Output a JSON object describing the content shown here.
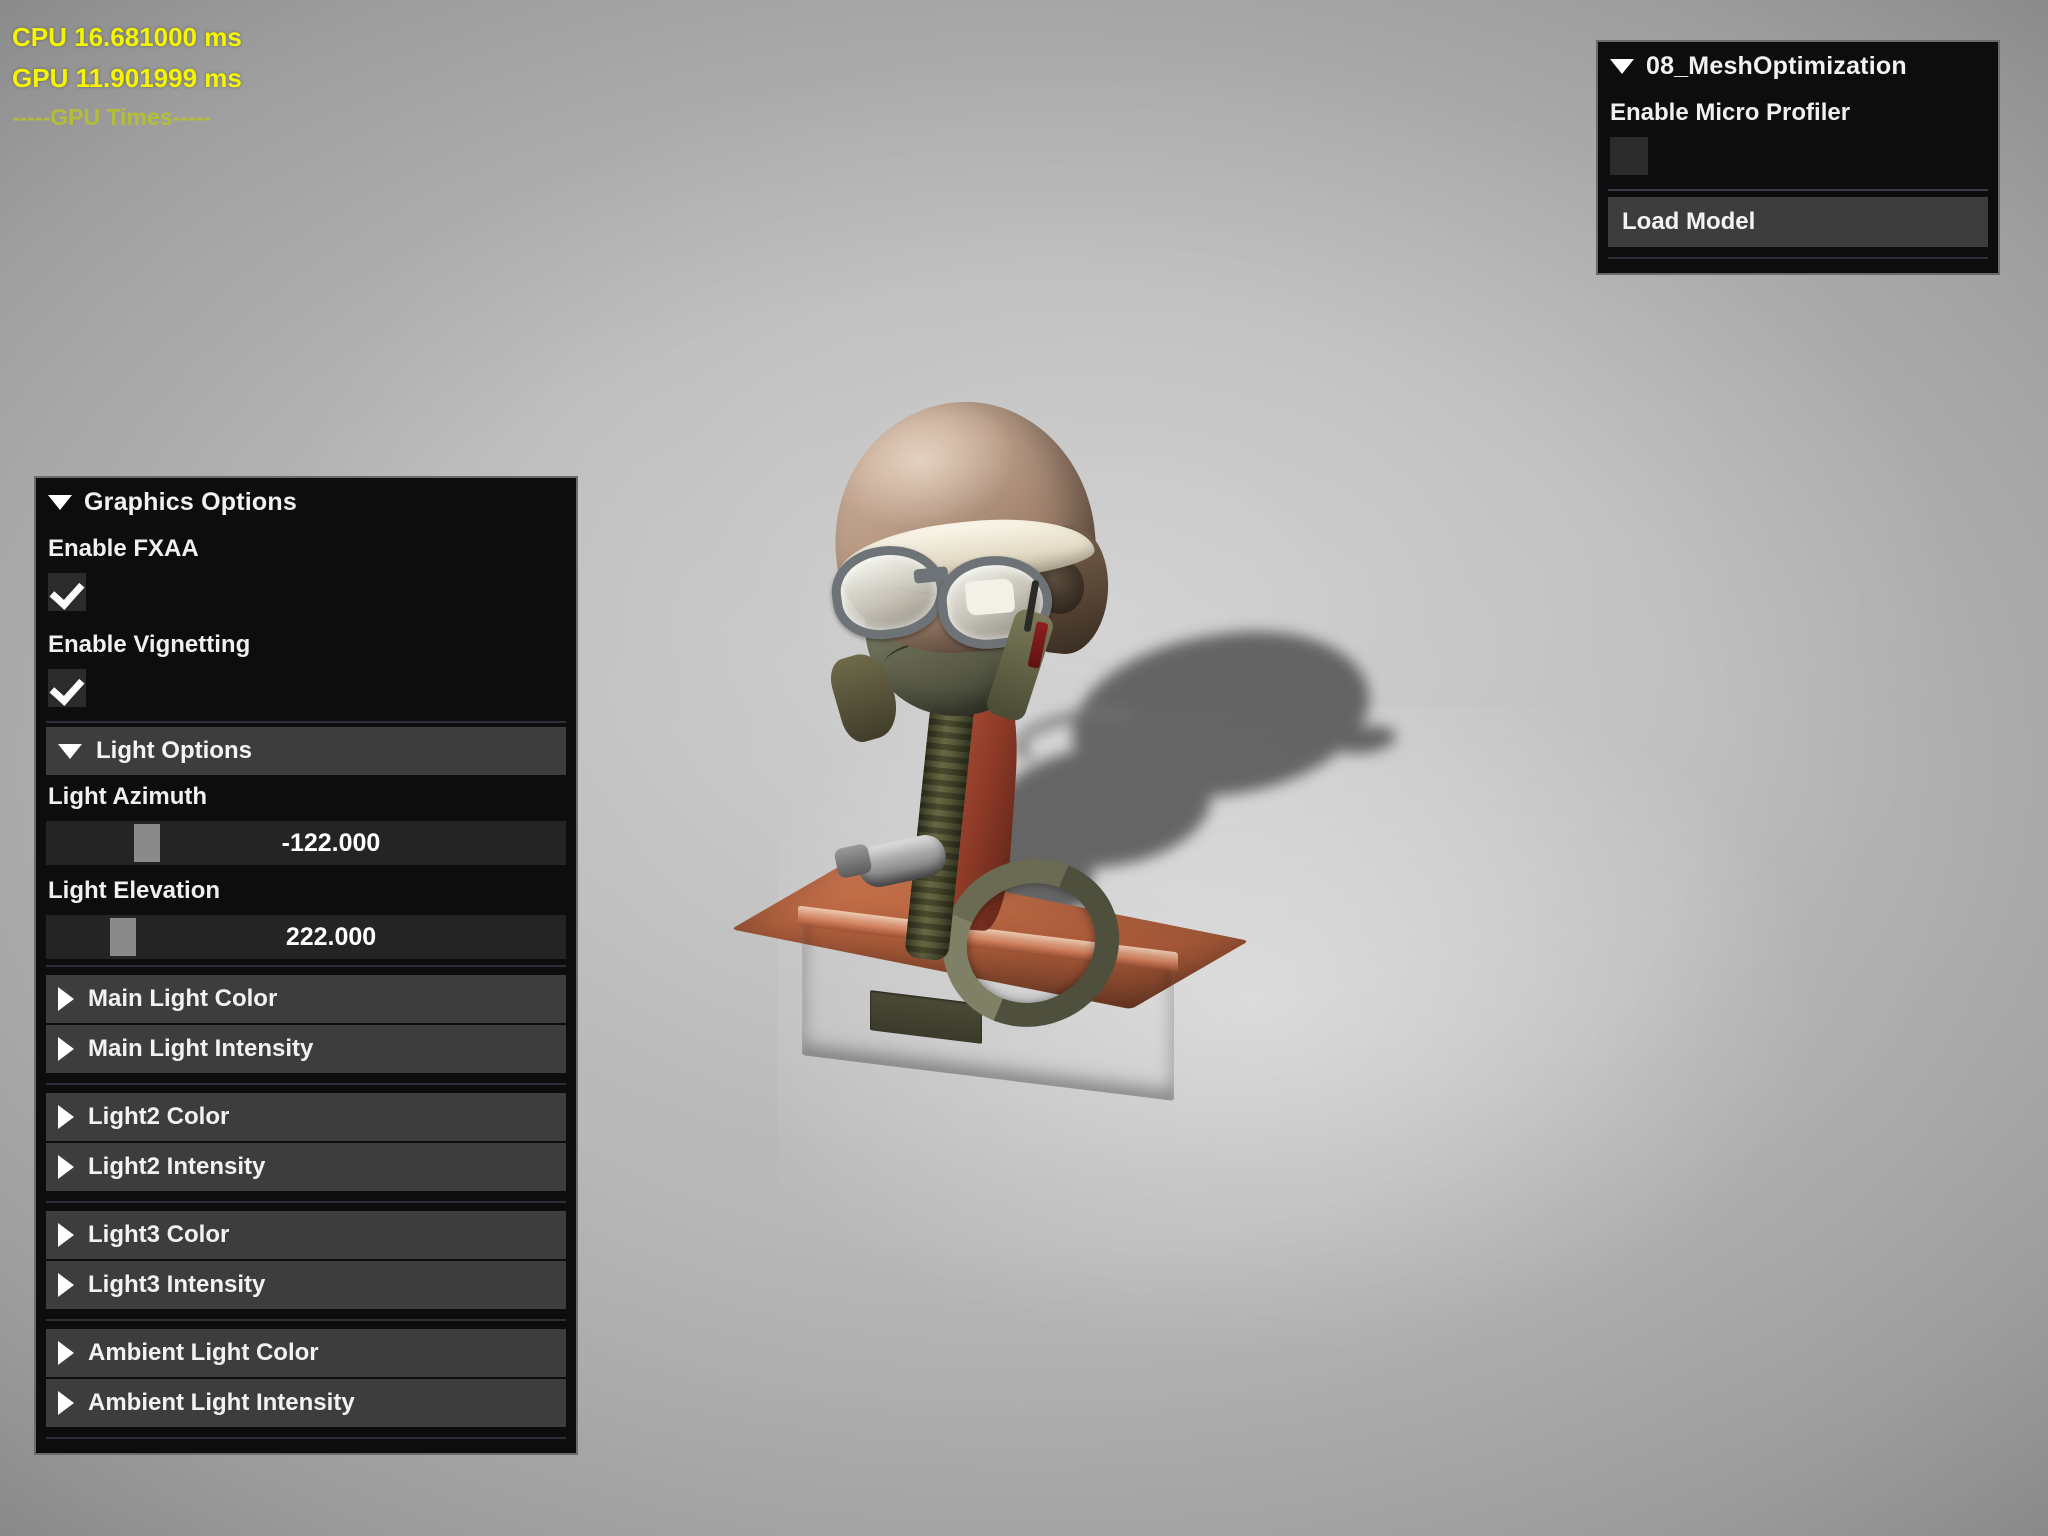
{
  "perf": {
    "cpu": "CPU 16.681000 ms",
    "gpu": "GPU 11.901999 ms",
    "gpu_times_header": "-----GPU Times-----"
  },
  "app_panel": {
    "title": "08_MeshOptimization",
    "collapse_icon": "triangle-down-icon",
    "enable_micro_profiler_label": "Enable Micro Profiler",
    "enable_micro_profiler_checked": false,
    "load_model_label": "Load Model"
  },
  "graphics_panel": {
    "title": "Graphics Options",
    "collapse_icon": "triangle-down-icon",
    "enable_fxaa_label": "Enable FXAA",
    "enable_fxaa_checked": true,
    "enable_vignetting_label": "Enable Vignetting",
    "enable_vignetting_checked": true,
    "light_options": {
      "title": "Light Options",
      "collapse_icon": "triangle-down-icon",
      "light_azimuth_label": "Light Azimuth",
      "light_azimuth_value": "-122.000",
      "light_elevation_label": "Light Elevation",
      "light_elevation_value": "222.000"
    },
    "rows": [
      {
        "label": "Main Light Color"
      },
      {
        "label": "Main Light Intensity"
      },
      {
        "label": "Light2 Color"
      },
      {
        "label": "Light2 Intensity"
      },
      {
        "label": "Light3 Color"
      },
      {
        "label": "Light3 Intensity"
      },
      {
        "label": "Ambient Light Color"
      },
      {
        "label": "Ambient Light Intensity"
      }
    ]
  },
  "viewport": {
    "scene_description": "3D rendered pilot flight helmet with goggles and oxygen mask on a wooden display base"
  },
  "colors": {
    "perf_text": "#f5f500",
    "perf_sep_text": "#b8c427",
    "panel_bg": "#0d0d0d",
    "panel_border": "#6b6b6b",
    "row_bg": "#3d3d3d",
    "slider_track": "#242424",
    "slider_handle": "#8a8a8a",
    "background": "#b4b4b4"
  }
}
